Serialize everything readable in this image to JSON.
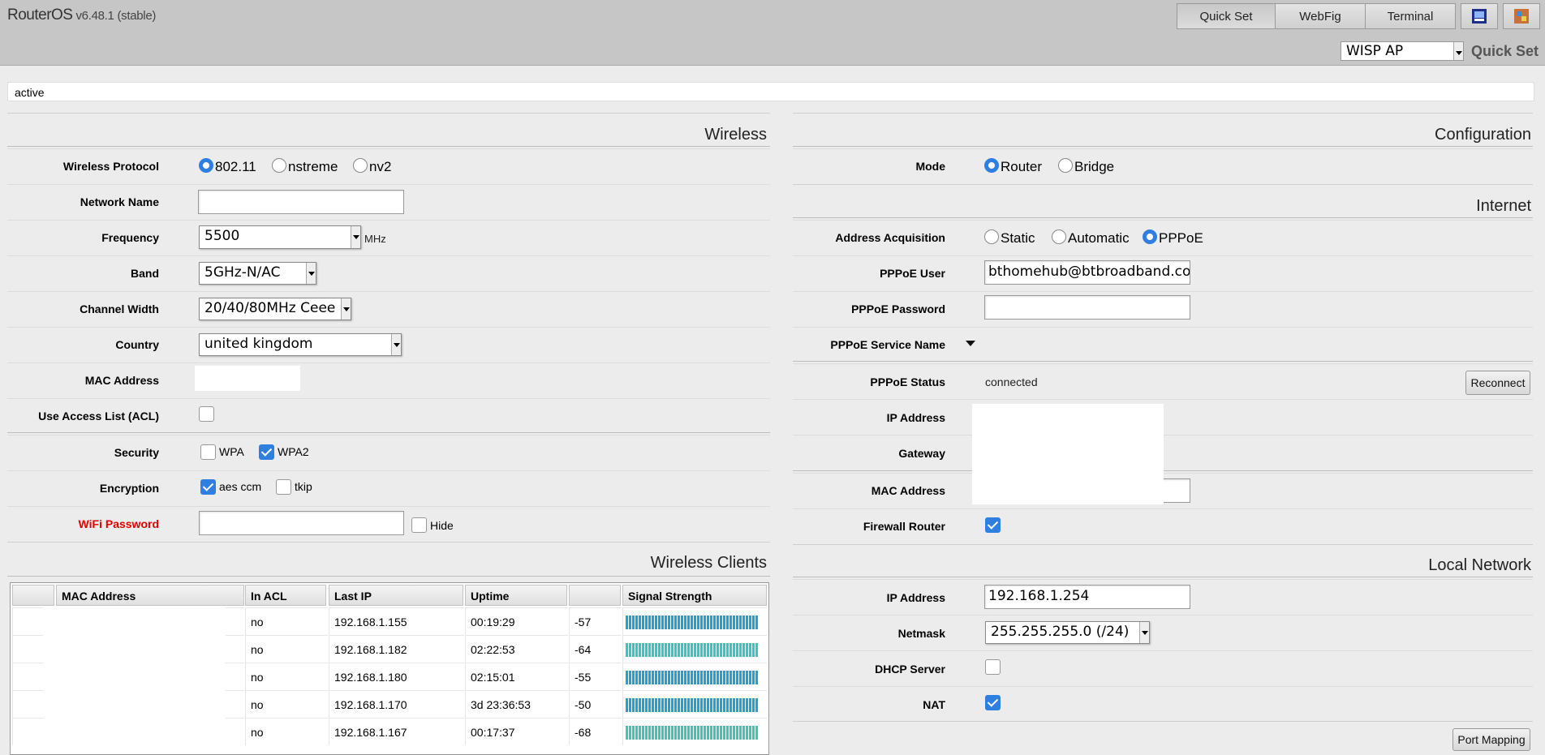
{
  "header": {
    "brand": "RouterOS",
    "version": "v6.48.1 (stable)",
    "nav": [
      "Quick Set",
      "WebFig",
      "Terminal"
    ],
    "mode_select": "WISP AP",
    "title": "Quick Set"
  },
  "status_text": "active",
  "wireless": {
    "title": "Wireless",
    "protocol": {
      "label": "Wireless Protocol",
      "options": [
        "802.11",
        "nstreme",
        "nv2"
      ],
      "selected": "802.11"
    },
    "network_name": {
      "label": "Network Name",
      "value": ""
    },
    "frequency": {
      "label": "Frequency",
      "value": "5500",
      "unit": "MHz"
    },
    "band": {
      "label": "Band",
      "value": "5GHz-N/AC"
    },
    "channel_width": {
      "label": "Channel Width",
      "value": "20/40/80MHz Ceee"
    },
    "country": {
      "label": "Country",
      "value": "united kingdom"
    },
    "mac_address": {
      "label": "MAC Address"
    },
    "acl": {
      "label": "Use Access List (ACL)",
      "checked": false
    },
    "security": {
      "label": "Security",
      "wpa": "WPA",
      "wpa2": "WPA2",
      "wpa_checked": false,
      "wpa2_checked": true
    },
    "encryption": {
      "label": "Encryption",
      "aes": "aes ccm",
      "tkip": "tkip",
      "aes_checked": true,
      "tkip_checked": false
    },
    "wifi_password": {
      "label": "WiFi Password",
      "value": "",
      "hide_label": "Hide"
    }
  },
  "clients": {
    "title": "Wireless Clients",
    "columns": [
      "",
      "MAC Address",
      "In ACL",
      "Last IP",
      "Uptime",
      "",
      "Signal Strength"
    ],
    "rows": [
      {
        "acl": "no",
        "ip": "192.168.1.155",
        "uptime": "00:19:29",
        "signal": "-57",
        "color": "#1da3dc"
      },
      {
        "acl": "no",
        "ip": "192.168.1.182",
        "uptime": "02:22:53",
        "signal": "-64",
        "color": "#2ec8c8"
      },
      {
        "acl": "no",
        "ip": "192.168.1.180",
        "uptime": "02:15:01",
        "signal": "-55",
        "color": "#1da3dc"
      },
      {
        "acl": "no",
        "ip": "192.168.1.170",
        "uptime": "3d 23:36:53",
        "signal": "-50",
        "color": "#1da3dc"
      },
      {
        "acl": "no",
        "ip": "192.168.1.167",
        "uptime": "00:17:37",
        "signal": "-68",
        "color": "#3cc8b4"
      }
    ]
  },
  "configuration": {
    "title": "Configuration",
    "mode": {
      "label": "Mode",
      "options": [
        "Router",
        "Bridge"
      ],
      "selected": "Router"
    }
  },
  "internet": {
    "title": "Internet",
    "acquisition": {
      "label": "Address Acquisition",
      "options": [
        "Static",
        "Automatic",
        "PPPoE"
      ],
      "selected": "PPPoE"
    },
    "pppoe_user": {
      "label": "PPPoE User",
      "value": "bthomehub@btbroadband.com"
    },
    "pppoe_password": {
      "label": "PPPoE Password",
      "value": ""
    },
    "service_name": {
      "label": "PPPoE Service Name"
    },
    "pppoe_status": {
      "label": "PPPoE Status",
      "value": "connected",
      "button": "Reconnect"
    },
    "ip_address": {
      "label": "IP Address"
    },
    "gateway": {
      "label": "Gateway"
    },
    "mac_address": {
      "label": "MAC Address"
    },
    "firewall": {
      "label": "Firewall Router",
      "checked": true
    }
  },
  "local": {
    "title": "Local Network",
    "ip_address": {
      "label": "IP Address",
      "value": "192.168.1.254"
    },
    "netmask": {
      "label": "Netmask",
      "value": "255.255.255.0 (/24)"
    },
    "dhcp": {
      "label": "DHCP Server",
      "checked": false
    },
    "nat": {
      "label": "NAT",
      "checked": true
    },
    "port_mapping": "Port Mapping"
  }
}
